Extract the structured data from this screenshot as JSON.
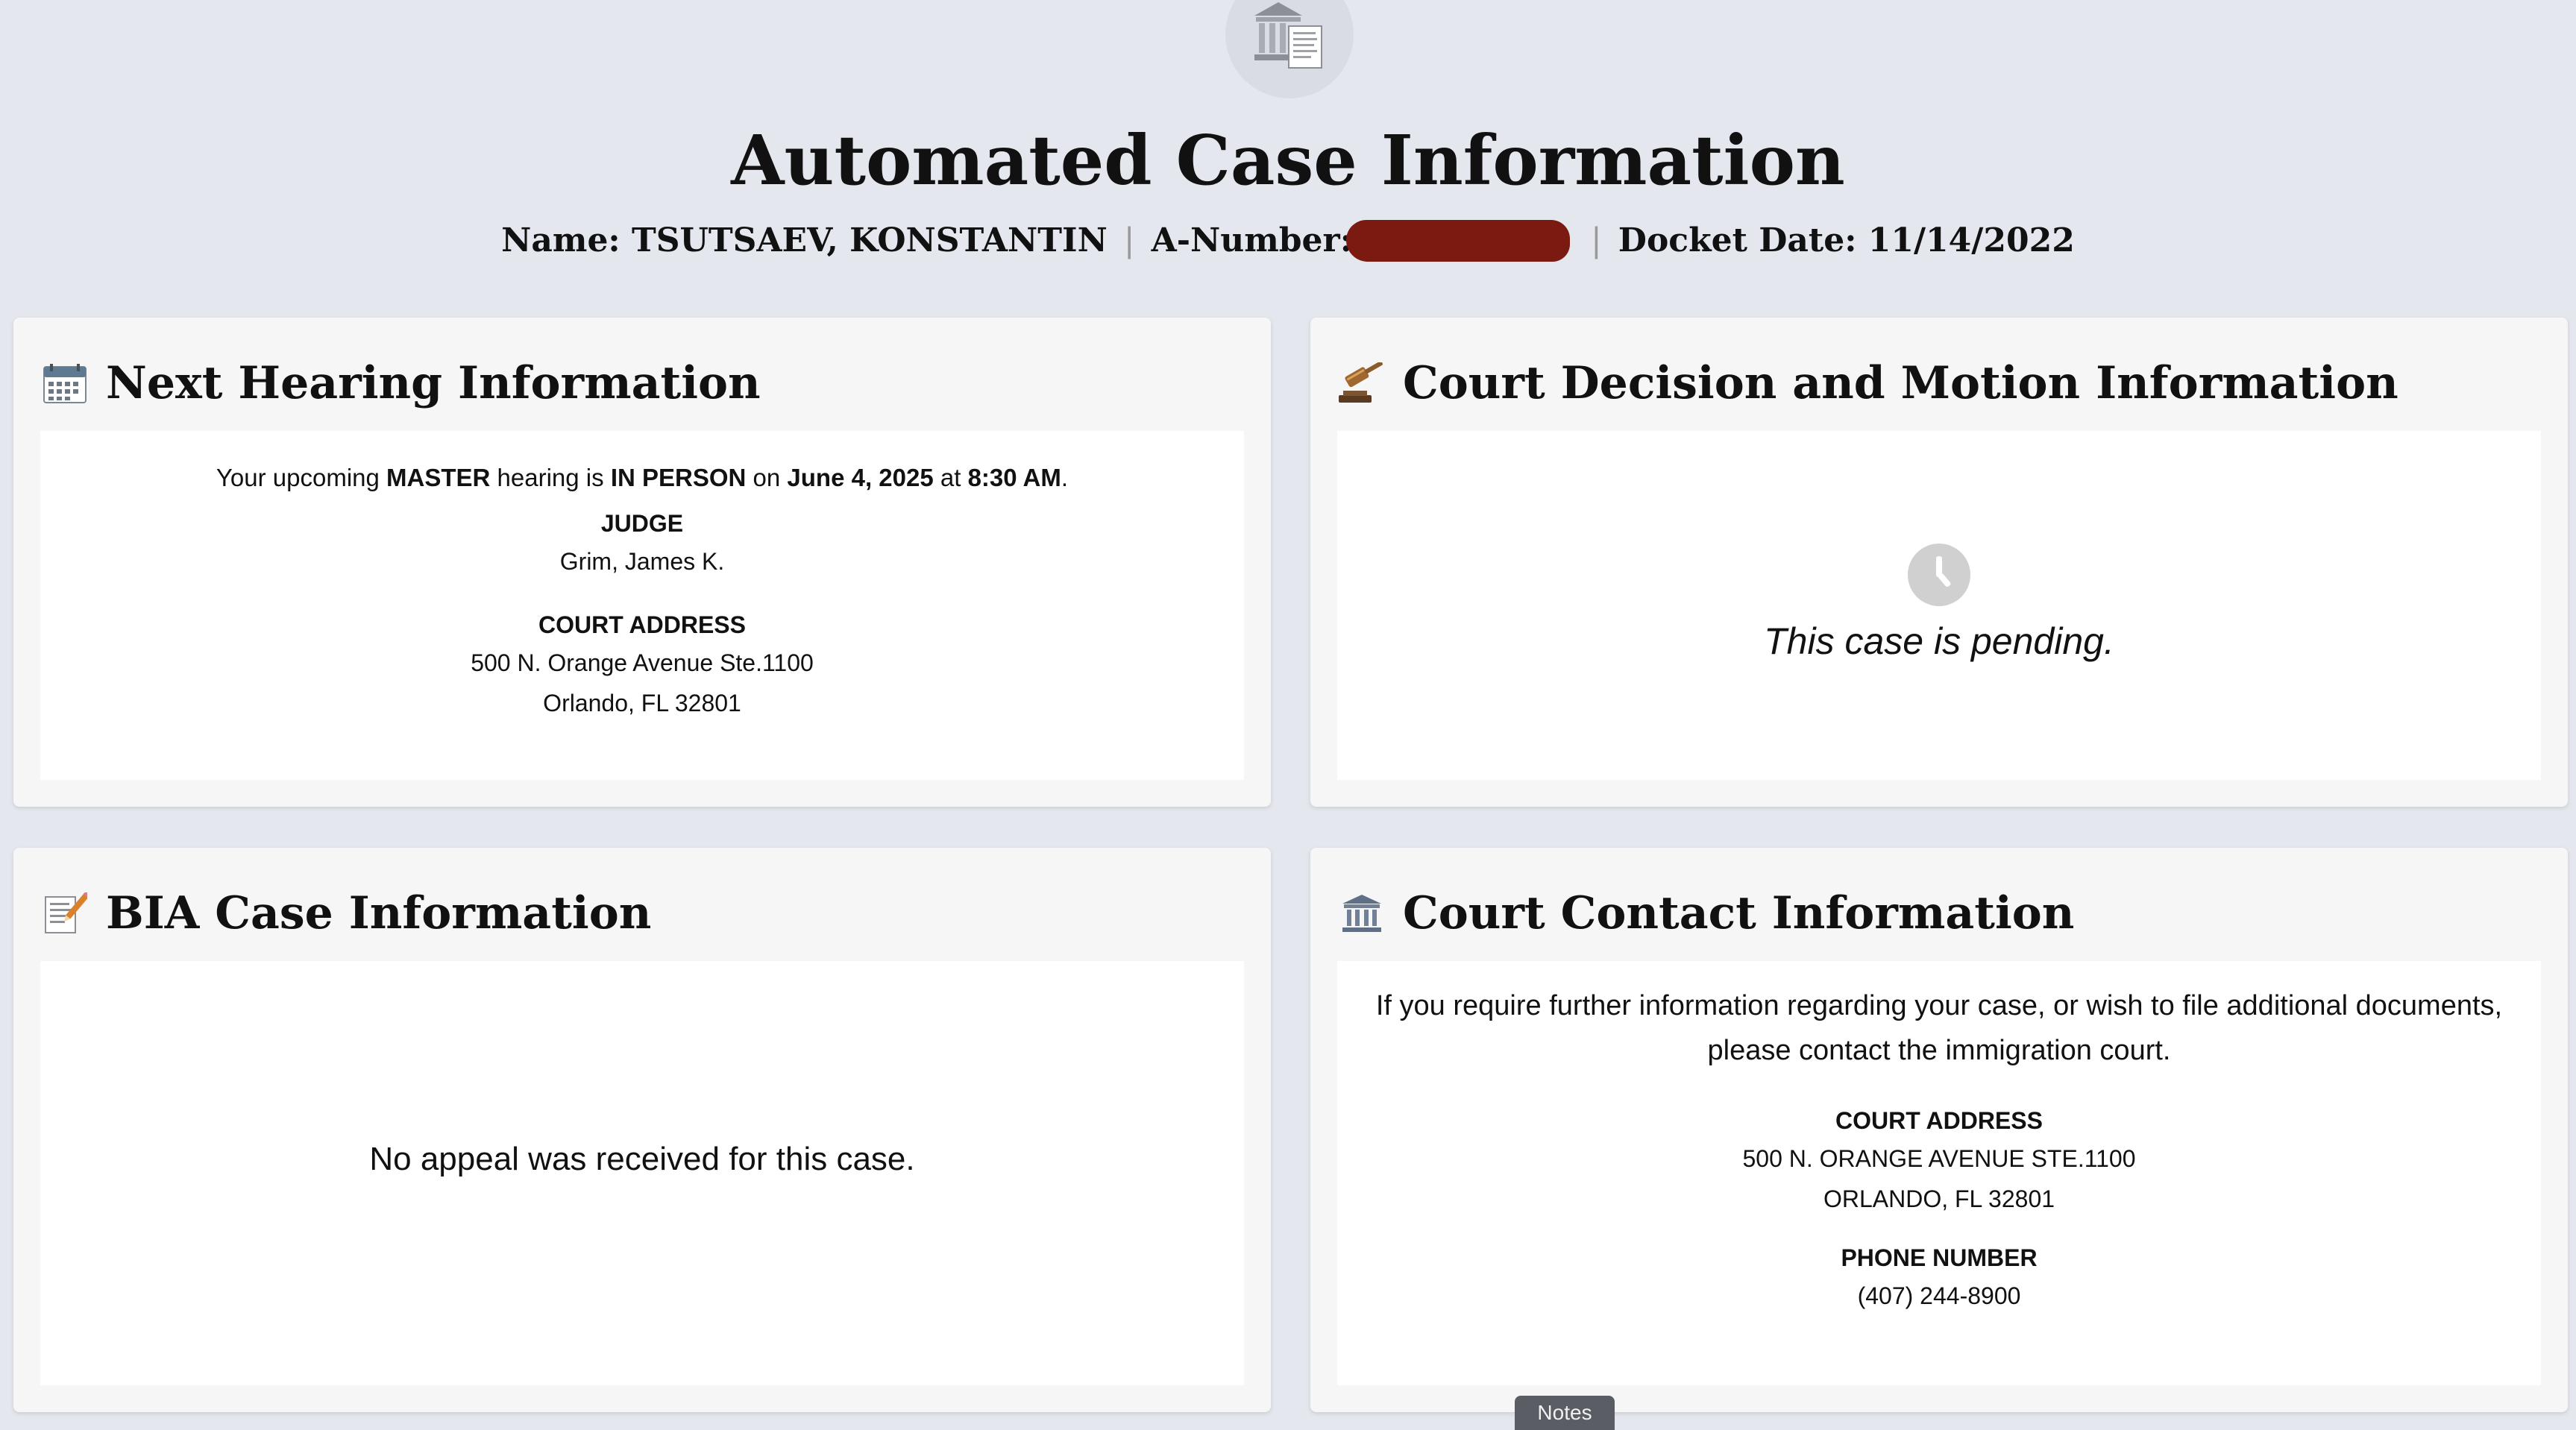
{
  "header": {
    "logo_icon": "courthouse-document-icon",
    "title": "Automated Case Information",
    "name_label": "Name: TSUTSAEV, KONSTANTIN",
    "a_number_label": "A-Number:",
    "docket_label": "Docket Date: 11/14/2022",
    "separator": "|"
  },
  "next_hearing": {
    "icon": "calendar-icon",
    "title": "Next Hearing Information",
    "sentence_prefix": "Your upcoming ",
    "hearing_type": "MASTER",
    "sentence_mid1": " hearing is ",
    "hearing_mode": "IN PERSON",
    "sentence_mid2": " on ",
    "hearing_date": "June 4, 2025",
    "sentence_mid3": " at ",
    "hearing_time": "8:30 AM",
    "sentence_end": ".",
    "judge_label": "JUDGE",
    "judge_name": "Grim, James K.",
    "court_address_label": "COURT ADDRESS",
    "address_line1": "500 N. Orange Avenue Ste.1100",
    "address_line2": "Orlando, FL 32801"
  },
  "court_decision": {
    "icon": "gavel-icon",
    "title": "Court Decision and Motion Information",
    "status_icon": "clock-icon",
    "status_text": "This case is pending."
  },
  "bia": {
    "icon": "memo-pencil-icon",
    "title": "BIA Case Information",
    "message": "No appeal was received for this case."
  },
  "court_contact": {
    "icon": "courthouse-icon",
    "title": "Court Contact Information",
    "intro_line1": "If you require further information regarding your case, or wish to file additional documents,",
    "intro_line2": "please contact the immigration court.",
    "court_address_label": "COURT ADDRESS",
    "address_line1": "500 N. ORANGE AVENUE STE.1100",
    "address_line2": "ORLANDO, FL 32801",
    "phone_label": "PHONE NUMBER",
    "phone": "(407) 244-8900"
  },
  "notes_tab": {
    "label": "Notes"
  },
  "colors": {
    "background": "#e4e8ee",
    "card": "#f6f6f6",
    "redaction": "#7a1a10",
    "notes_tab": "#5a5d63"
  }
}
